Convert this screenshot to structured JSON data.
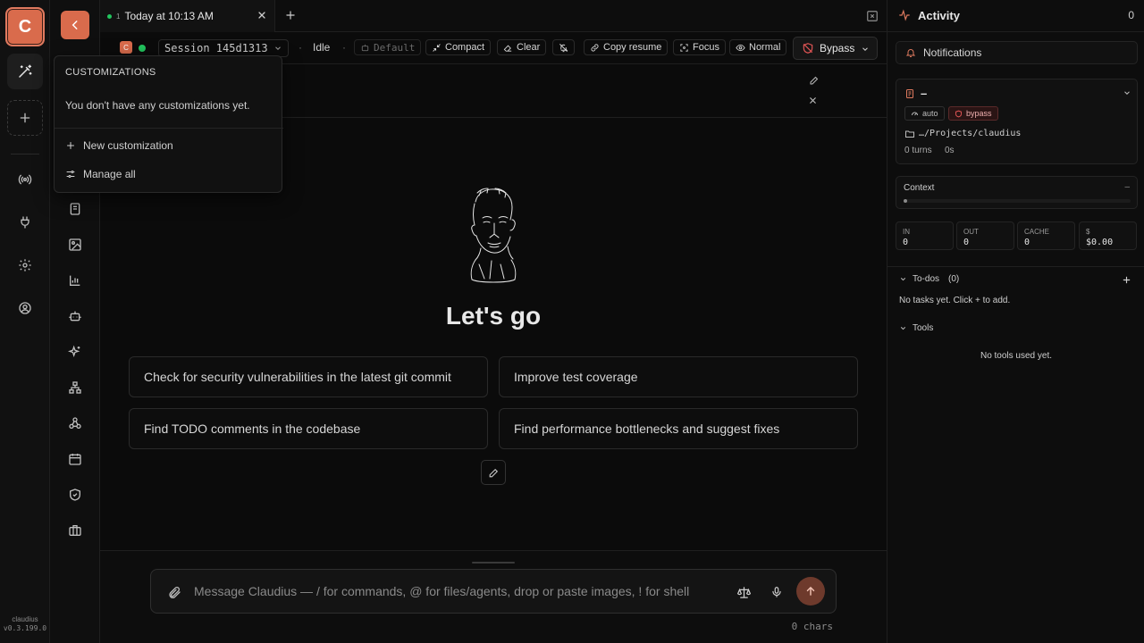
{
  "rail": {
    "logo_letter": "C",
    "version_name": "claudius",
    "version_num": "v0.3.199.0"
  },
  "tab": {
    "number": "1",
    "title": "Today at 10:13 AM"
  },
  "toolbar": {
    "session_label": "Session 145d1313",
    "badge_letter": "C",
    "separator": "·",
    "status": "Idle",
    "model": "Default",
    "compact": "Compact",
    "clear": "Clear",
    "copy_resume": "Copy resume",
    "focus": "Focus",
    "normal": "Normal",
    "bypass": "Bypass"
  },
  "popover": {
    "heading": "CUSTOMIZATIONS",
    "empty_text": "You don't have any customizations yet.",
    "new_item": "New customization",
    "manage_item": "Manage all"
  },
  "hero": {
    "title": "Let's go"
  },
  "suggestions": [
    "Check for security vulnerabilities in the latest git commit",
    "Improve test coverage",
    "Find TODO comments in the codebase",
    "Find performance bottlenecks and suggest fixes"
  ],
  "composer": {
    "placeholder": "Message Claudius — / for commands, @ for files/agents, drop or paste images, ! for shell",
    "chars": "0 chars"
  },
  "activity": {
    "title": "Activity",
    "count": "0",
    "notifications": "Notifications",
    "session_name": "–",
    "badge_auto": "auto",
    "badge_bypass": "bypass",
    "path": "…/Projects/claudius",
    "turns": "0 turns",
    "duration": "0s",
    "context_label": "Context",
    "context_value": "–",
    "stats": [
      {
        "label": "IN",
        "value": "0"
      },
      {
        "label": "OUT",
        "value": "0"
      },
      {
        "label": "CACHE",
        "value": "0"
      },
      {
        "label": "$",
        "value": "$0.00"
      }
    ],
    "todos_label": "To-dos",
    "todos_count": "(0)",
    "todos_empty": "No tasks yet. Click + to add.",
    "tools_label": "Tools",
    "tools_empty": "No tools used yet."
  },
  "colors": {
    "accent": "#d96b4c",
    "status_green": "#22c55e",
    "bypass_red": "#e25555"
  }
}
